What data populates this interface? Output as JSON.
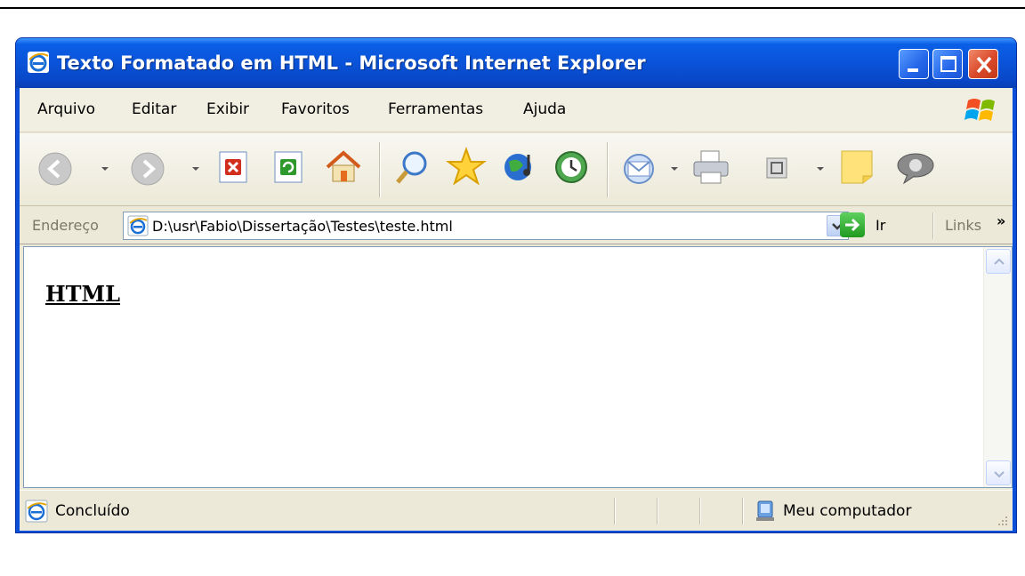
{
  "window": {
    "title": "Texto Formatado em HTML - Microsoft Internet Explorer"
  },
  "menu": {
    "items": [
      {
        "label": "Arquivo"
      },
      {
        "label": "Editar"
      },
      {
        "label": "Exibir"
      },
      {
        "label": "Favoritos"
      },
      {
        "label": "Ferramentas"
      },
      {
        "label": "Ajuda"
      }
    ]
  },
  "toolbar": {
    "buttons": [
      "back-icon",
      "forward-icon",
      "stop-icon",
      "refresh-icon",
      "home-icon",
      "search-icon",
      "favorites-icon",
      "media-icon",
      "history-icon",
      "mail-icon",
      "print-icon",
      "edit-icon",
      "notes-icon",
      "messenger-icon"
    ]
  },
  "address": {
    "label": "Endereço",
    "value": "D:\\usr\\Fabio\\Dissertação\\Testes\\teste.html",
    "go_label": "Ir",
    "links_label": "Links",
    "chevron": "»"
  },
  "content": {
    "heading": "HTML"
  },
  "status": {
    "text": "Concluído",
    "zone": "Meu computador"
  },
  "colors": {
    "titlebar": "#0a53d8",
    "chrome": "#ece9d8",
    "close_button": "#d9492a"
  }
}
